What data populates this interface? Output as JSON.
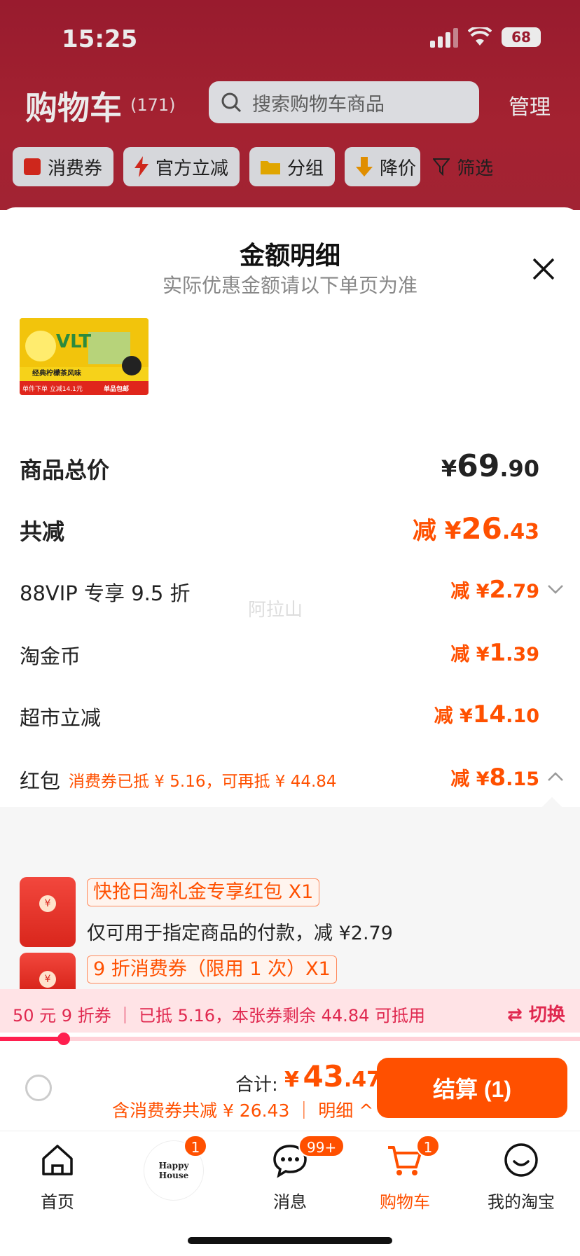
{
  "status_bar": {
    "time": "15:25",
    "battery": "68"
  },
  "header": {
    "title": "购物车",
    "count": "(171)",
    "search_placeholder": "搜索购物车商品",
    "manage": "管理"
  },
  "filters": [
    {
      "label": "消费券",
      "icon": "coupon-icon",
      "color": "#e02b1f"
    },
    {
      "label": "官方立减",
      "icon": "lightning-icon",
      "color": "#e02b1f"
    },
    {
      "label": "分组",
      "icon": "folder-icon",
      "color": "#f4b400"
    },
    {
      "label": "降价",
      "icon": "arrow-down-icon",
      "color": "#f49b00"
    },
    {
      "label": "筛选",
      "icon": "filter-icon",
      "color": "#222222"
    }
  ],
  "sheet": {
    "title": "金额明细",
    "subtitle": "实际优惠金额请以下单页为准",
    "product_image": {
      "brand_text": "VLT",
      "caption": "经典柠檬茶风味",
      "promo1": "单件下单 立减14.1元",
      "promo2": "单品包邮"
    },
    "rows": {
      "total": {
        "label": "商品总价",
        "yen": "¥",
        "int": "69",
        "dec": ".90"
      },
      "reduce": {
        "label": "共减",
        "prefix": "减 ¥",
        "int": "26",
        "dec": ".43"
      },
      "vip": {
        "label": "88VIP 专享 9.5 折",
        "prefix": "减 ¥",
        "int": "2",
        "dec": ".79"
      },
      "coin": {
        "label": "淘金币",
        "prefix": "减 ¥",
        "int": "1",
        "dec": ".39"
      },
      "market": {
        "label": "超市立减",
        "prefix": "减 ¥",
        "int": "14",
        "dec": ".10"
      },
      "hongbao": {
        "label": "红包",
        "note": "消费券已抵 ¥ 5.16，可再抵 ¥ 44.84",
        "prefix": "减 ¥",
        "int": "8",
        "dec": ".15"
      }
    },
    "watermark": "阿拉山",
    "coupons": [
      {
        "tag": "快抢日淘礼金专享红包 X1",
        "desc": "仅可用于指定商品的付款，减 ¥2.79"
      },
      {
        "tag": "9 折消费券（限用 1 次）X1",
        "desc": ""
      }
    ]
  },
  "strip": {
    "text": "50 元 9 折券 ｜ 已抵 5.16，本张券剩余 44.84 可抵用",
    "switch": "⇄ 切换",
    "progress": 0.11
  },
  "checkout": {
    "total_label": "合计:",
    "yen": "¥",
    "int": "43",
    "dec": ".47",
    "discount": "含消费券共减 ¥ 26.43 ｜ 明细 ^",
    "pay": "结算 (1)"
  },
  "tabbar": {
    "home": "首页",
    "happy": "Happy House",
    "happy_badge": "1",
    "msg": "消息",
    "msg_badge": "99+",
    "cart": "购物车",
    "cart_badge": "1",
    "mine": "我的淘宝"
  },
  "colors": {
    "accent": "#ff5000",
    "header": "#a61e32",
    "coupon_red": "#e0284f"
  }
}
